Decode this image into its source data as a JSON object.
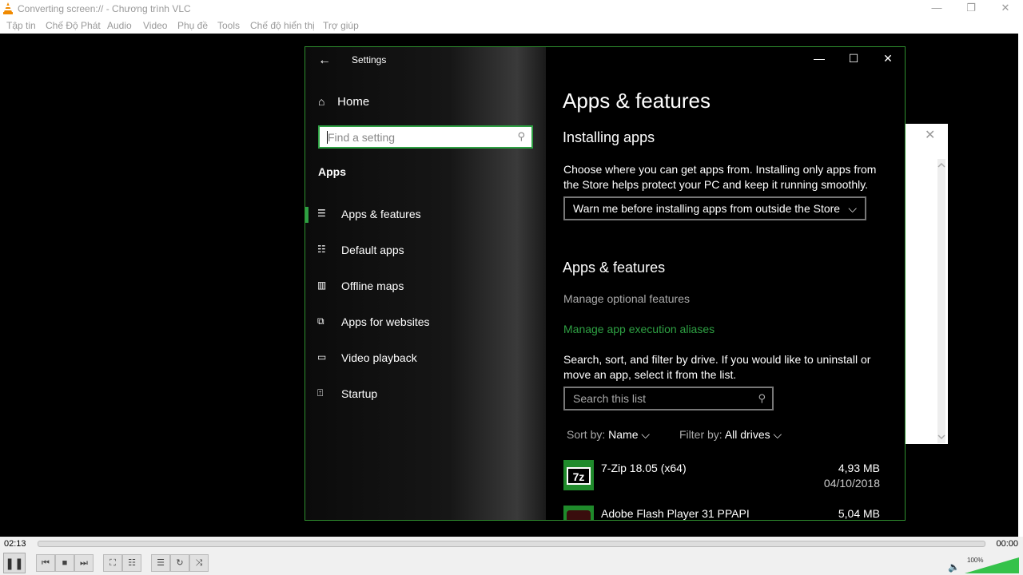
{
  "vlc": {
    "title": "Converting screen:// - Chương trình VLC",
    "menu": [
      "Tập tin",
      "Chế Độ Phát",
      "Audio",
      "Video",
      "Phụ đề",
      "Tools",
      "Chế độ hiển thị",
      "Trợ giúp"
    ],
    "time_elapsed": "02:13",
    "time_total": "00:00",
    "volume_label": "100%",
    "volume_level": 1.0
  },
  "settings": {
    "title": "Settings",
    "home": "Home",
    "search_placeholder": "Find a setting",
    "group": "Apps",
    "nav_items": [
      {
        "label": "Apps & features",
        "icon": "list-icon",
        "selected": true
      },
      {
        "label": "Default apps",
        "icon": "default-apps-icon"
      },
      {
        "label": "Offline maps",
        "icon": "map-icon"
      },
      {
        "label": "Apps for websites",
        "icon": "website-icon"
      },
      {
        "label": "Video playback",
        "icon": "video-icon"
      },
      {
        "label": "Startup",
        "icon": "startup-icon"
      }
    ],
    "page_title": "Apps & features",
    "installing_heading": "Installing apps",
    "installing_desc": "Choose where you can get apps from. Installing only apps from the Store helps protect your PC and keep it running smoothly.",
    "install_dropdown": "Warn me before installing apps from outside the Store",
    "apps_heading": "Apps & features",
    "link_optional": "Manage optional features",
    "link_aliases": "Manage app execution aliases",
    "list_desc": "Search, sort, and filter by drive. If you would like to uninstall or move an app, select it from the list.",
    "list_search_placeholder": "Search this list",
    "sort_label": "Sort by:",
    "sort_value": "Name",
    "filter_label": "Filter by:",
    "filter_value": "All drives",
    "apps": [
      {
        "name": "7-Zip 18.05 (x64)",
        "size": "4,93 MB",
        "date": "04/10/2018",
        "logo": "7z"
      },
      {
        "name": "Adobe Flash Player 31 PPAPI",
        "size": "5,04 MB",
        "date": ""
      }
    ]
  },
  "colors": {
    "accent": "#2ea043",
    "link_gray": "#aaaaaa",
    "link_green": "#2ea043"
  }
}
